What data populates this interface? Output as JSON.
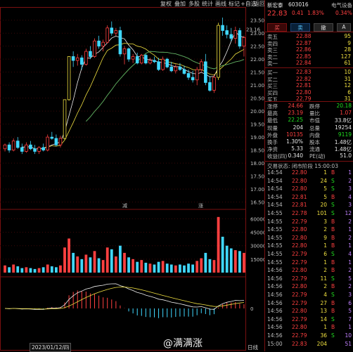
{
  "toolbar": {
    "items": [
      "复权",
      "叠加",
      "多股",
      "统计",
      "画线",
      "标记",
      "+自选",
      "返回"
    ]
  },
  "axis": {
    "price_ticks": [
      "23.50",
      "23.00",
      "22.50",
      "22.00",
      "21.50",
      "21.00",
      "20.50",
      "20.00",
      "19.50",
      "19.00",
      "18.50",
      "18.00",
      "17.50",
      "17.00",
      "16.50"
    ],
    "price_high_label": "23.16",
    "volume_ticks": [
      "60000",
      "45000",
      "30000",
      "15000"
    ],
    "macd_ticks": [
      "0"
    ],
    "date_label": "2023/01/12/四",
    "period_label": "日线",
    "markers": [
      "减",
      "涨"
    ]
  },
  "quote": {
    "name": "新宏泰",
    "code": "603016",
    "sector": "电气设备",
    "price": "22.83",
    "change": "0.41",
    "change_pct": "1.83%",
    "sector_pct": "0.34%",
    "buttons": [
      "买",
      "卖",
      "撤",
      "A"
    ]
  },
  "order_book": {
    "asks": [
      {
        "label": "卖五",
        "price": "22.88",
        "vol": "95"
      },
      {
        "label": "卖四",
        "price": "22.87",
        "vol": "9"
      },
      {
        "label": "卖三",
        "price": "22.86",
        "vol": "28"
      },
      {
        "label": "卖二",
        "price": "22.85",
        "vol": "127"
      },
      {
        "label": "卖一",
        "price": "22.84",
        "vol": "61"
      }
    ],
    "bids": [
      {
        "label": "买一",
        "price": "22.83",
        "vol": "10"
      },
      {
        "label": "买二",
        "price": "22.82",
        "vol": "31"
      },
      {
        "label": "买三",
        "price": "22.81",
        "vol": "12"
      },
      {
        "label": "买四",
        "price": "22.80",
        "vol": "6"
      },
      {
        "label": "买五",
        "price": "22.79",
        "vol": "31"
      }
    ]
  },
  "stats": [
    {
      "l1": "涨停",
      "v1": "24.66",
      "c1": "red",
      "l2": "跌停",
      "v2": "20.18",
      "c2": "green"
    },
    {
      "l1": "最高",
      "v1": "23.19",
      "c1": "red",
      "l2": "量比",
      "v2": "1.07",
      "c2": "red"
    },
    {
      "l1": "最低",
      "v1": "22.25",
      "c1": "green",
      "l2": "市值",
      "v2": "33.8亿",
      "c2": "white"
    },
    {
      "l1": "现量",
      "v1": "204",
      "c1": "white",
      "l2": "总量",
      "v2": "19254",
      "c2": "white"
    },
    {
      "l1": "外盘",
      "v1": "10135",
      "c1": "red",
      "l2": "内盘",
      "v2": "9119",
      "c2": "green"
    },
    {
      "l1": "换手",
      "v1": "1.30%",
      "c1": "white",
      "l2": "股本",
      "v2": "1.48亿",
      "c2": "white"
    },
    {
      "l1": "净资",
      "v1": "5.33",
      "c1": "white",
      "l2": "流通",
      "v2": "1.48亿",
      "c2": "white"
    },
    {
      "l1": "收益(四)",
      "v1": "0.340",
      "c1": "white",
      "l2": "PE(动)",
      "v2": "51.0",
      "c2": "white"
    }
  ],
  "trade_status": "交易状态: 闭市阶段 15:00:03",
  "ticks": [
    {
      "t": "14:54",
      "p": "22.80",
      "v": "1",
      "s": "B",
      "n": "1",
      "pc": "red",
      "sc": "red"
    },
    {
      "t": "14:54",
      "p": "22.80",
      "v": "24",
      "s": "S",
      "n": "2",
      "pc": "red",
      "sc": "green"
    },
    {
      "t": "14:54",
      "p": "22.80",
      "v": "5",
      "s": "S",
      "n": "3",
      "pc": "red",
      "sc": "green"
    },
    {
      "t": "14:54",
      "p": "22.81",
      "v": "5",
      "s": "B",
      "n": "4",
      "pc": "red",
      "sc": "red"
    },
    {
      "t": "14:54",
      "p": "22.81",
      "v": "20",
      "s": "S",
      "n": "3",
      "pc": "red",
      "sc": "green"
    },
    {
      "t": "14:55",
      "p": "22.78",
      "v": "101",
      "s": "S",
      "n": "12",
      "pc": "red",
      "sc": "green"
    },
    {
      "t": "14:55",
      "p": "22.79",
      "v": "3",
      "s": "B",
      "n": "2",
      "pc": "red",
      "sc": "red"
    },
    {
      "t": "14:55",
      "p": "22.80",
      "v": "2",
      "s": "B",
      "n": "1",
      "pc": "red",
      "sc": "red"
    },
    {
      "t": "14:55",
      "p": "22.80",
      "v": "9",
      "s": "B",
      "n": "2",
      "pc": "red",
      "sc": "red"
    },
    {
      "t": "14:55",
      "p": "22.80",
      "v": "1",
      "s": "B",
      "n": "1",
      "pc": "red",
      "sc": "red"
    },
    {
      "t": "14:55",
      "p": "22.79",
      "v": "6",
      "s": "S",
      "n": "4",
      "pc": "red",
      "sc": "green"
    },
    {
      "t": "14:55",
      "p": "22.79",
      "v": "1",
      "s": "B",
      "n": "1",
      "pc": "red",
      "sc": "red"
    },
    {
      "t": "14:56",
      "p": "22.80",
      "v": "2",
      "s": "B",
      "n": "2",
      "pc": "red",
      "sc": "red"
    },
    {
      "t": "14:56",
      "p": "22.79",
      "v": "11",
      "s": "S",
      "n": "5",
      "pc": "red",
      "sc": "green"
    },
    {
      "t": "14:56",
      "p": "22.80",
      "v": "2",
      "s": "B",
      "n": "2",
      "pc": "red",
      "sc": "red"
    },
    {
      "t": "14:56",
      "p": "22.79",
      "v": "4",
      "s": "S",
      "n": "3",
      "pc": "red",
      "sc": "green"
    },
    {
      "t": "14:56",
      "p": "22.79",
      "v": "27",
      "s": "B",
      "n": "6",
      "pc": "red",
      "sc": "red"
    },
    {
      "t": "14:56",
      "p": "22.80",
      "v": "13",
      "s": "B",
      "n": "5",
      "pc": "red",
      "sc": "red"
    },
    {
      "t": "14:56",
      "p": "22.79",
      "v": "14",
      "s": "S",
      "n": "7",
      "pc": "red",
      "sc": "green"
    },
    {
      "t": "14:56",
      "p": "22.80",
      "v": "1",
      "s": "B",
      "n": "1",
      "pc": "red",
      "sc": "red"
    },
    {
      "t": "14:56",
      "p": "22.79",
      "v": "36",
      "s": "S",
      "n": "10",
      "pc": "red",
      "sc": "green"
    },
    {
      "t": "15:00",
      "p": "22.83",
      "v": "204",
      "s": "",
      "n": "51",
      "pc": "red",
      "sc": "red"
    }
  ],
  "watermark": "@满满涨",
  "chart_data": {
    "type": "candlestick",
    "ylim": [
      16.3,
      23.6
    ],
    "candles": [
      [
        18.55,
        18.75,
        18.45,
        18.7
      ],
      [
        18.7,
        18.8,
        18.4,
        18.5
      ],
      [
        18.5,
        18.95,
        18.45,
        18.85
      ],
      [
        18.85,
        19.0,
        18.55,
        18.6
      ],
      [
        18.6,
        18.75,
        18.35,
        18.45
      ],
      [
        18.45,
        18.8,
        18.4,
        18.7
      ],
      [
        18.7,
        18.85,
        18.5,
        18.55
      ],
      [
        18.55,
        18.7,
        18.35,
        18.45
      ],
      [
        18.45,
        18.65,
        18.35,
        18.6
      ],
      [
        18.6,
        18.75,
        18.45,
        18.5
      ],
      [
        18.5,
        19.1,
        18.45,
        19.0
      ],
      [
        19.0,
        19.2,
        18.9,
        18.95
      ],
      [
        18.95,
        19.1,
        18.65,
        18.7
      ],
      [
        18.7,
        19.05,
        18.6,
        18.95
      ],
      [
        18.95,
        20.45,
        18.9,
        20.44
      ],
      [
        20.44,
        21.9,
        20.4,
        22.1
      ],
      [
        22.1,
        22.3,
        21.7,
        21.95
      ],
      [
        21.95,
        22.2,
        21.75,
        22.05
      ],
      [
        22.05,
        22.15,
        21.6,
        21.8
      ],
      [
        21.8,
        22.4,
        21.75,
        22.3
      ],
      [
        22.3,
        22.5,
        22.0,
        22.1
      ],
      [
        22.1,
        22.8,
        22.05,
        22.7
      ],
      [
        22.7,
        22.9,
        22.4,
        22.5
      ],
      [
        22.5,
        22.75,
        22.3,
        22.65
      ],
      [
        22.65,
        23.3,
        22.6,
        23.2
      ],
      [
        23.2,
        23.45,
        22.9,
        23.0
      ],
      [
        23.0,
        23.2,
        22.9,
        23.1
      ],
      [
        23.1,
        23.25,
        22.1,
        22.2
      ],
      [
        22.2,
        22.5,
        21.8,
        22.4
      ],
      [
        22.4,
        22.45,
        21.9,
        22.0
      ],
      [
        22.0,
        22.2,
        21.85,
        22.1
      ],
      [
        22.1,
        22.25,
        21.8,
        21.85
      ],
      [
        21.85,
        22.2,
        21.8,
        22.15
      ],
      [
        22.15,
        22.2,
        21.8,
        21.85
      ],
      [
        21.85,
        22.05,
        21.8,
        21.95
      ],
      [
        21.95,
        22.1,
        21.85,
        21.9
      ],
      [
        21.9,
        22.05,
        21.55,
        21.6
      ],
      [
        21.6,
        22.1,
        21.55,
        22.0
      ],
      [
        22.0,
        22.05,
        21.65,
        21.7
      ],
      [
        21.7,
        21.9,
        21.5,
        21.55
      ],
      [
        21.55,
        21.8,
        21.45,
        21.7
      ],
      [
        21.7,
        21.85,
        21.55,
        21.6
      ],
      [
        21.6,
        21.75,
        21.4,
        21.45
      ],
      [
        21.45,
        21.6,
        21.2,
        21.3
      ],
      [
        21.3,
        21.55,
        21.1,
        21.2
      ],
      [
        21.2,
        21.7,
        21.0,
        21.6
      ],
      [
        21.6,
        22.0,
        21.5,
        21.9
      ],
      [
        21.9,
        22.2,
        21.0,
        21.1
      ],
      [
        21.1,
        21.35,
        20.75,
        20.8
      ],
      [
        20.8,
        21.4,
        20.7,
        21.3
      ],
      [
        21.3,
        23.4,
        21.2,
        23.3
      ],
      [
        23.3,
        23.6,
        22.9,
        23.1
      ],
      [
        23.1,
        23.3,
        22.8,
        22.95
      ],
      [
        22.95,
        23.2,
        22.7,
        22.8
      ],
      [
        22.8,
        23.25,
        22.6,
        23.1
      ],
      [
        23.1,
        23.2,
        22.4,
        22.5
      ],
      [
        22.5,
        22.9,
        22.1,
        22.83
      ]
    ],
    "volume": [
      8,
      6,
      9,
      7,
      5,
      6,
      5,
      4,
      5,
      6,
      9,
      7,
      6,
      8,
      28,
      38,
      22,
      18,
      15,
      20,
      17,
      24,
      16,
      14,
      28,
      26,
      18,
      30,
      22,
      17,
      15,
      12,
      14,
      11,
      10,
      9,
      12,
      13,
      10,
      9,
      8,
      9,
      8,
      10,
      9,
      13,
      16,
      22,
      15,
      14,
      62,
      40,
      30,
      27,
      25,
      24,
      22
    ],
    "volume_ylim": [
      0,
      65000
    ],
    "macd_ylim": [
      -1,
      1
    ]
  }
}
